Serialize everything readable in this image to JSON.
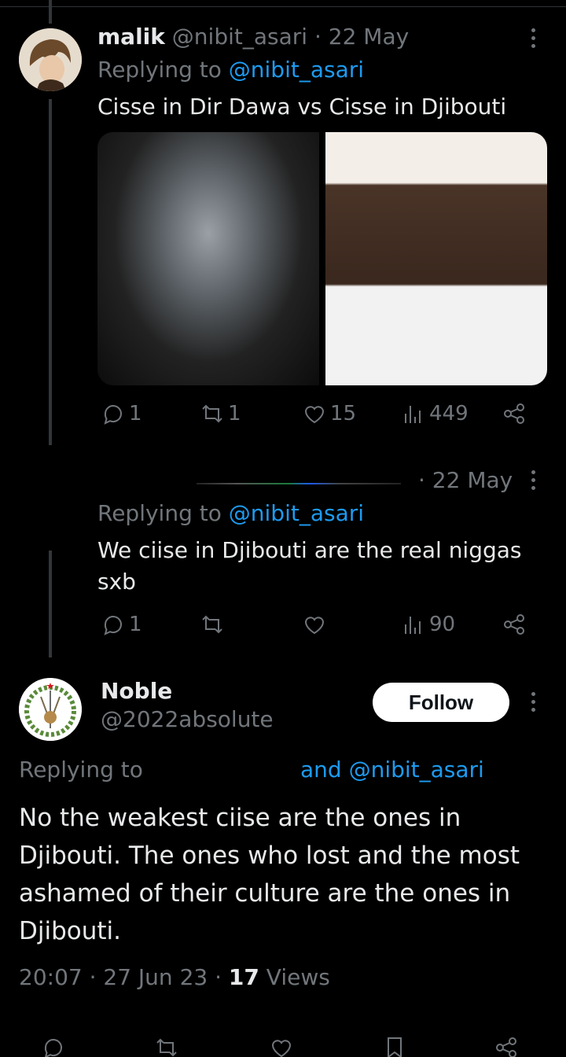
{
  "tweet1": {
    "name": "malik",
    "handle": "@nibit_asari",
    "date": "· 22 May",
    "replying_prefix": "Replying to",
    "replying_to": "@nibit_asari",
    "text": "Cisse in Dir Dawa vs Cisse in Djibouti",
    "stats": {
      "replies": "1",
      "reposts": "1",
      "likes": "15",
      "views": "449"
    }
  },
  "tweet2": {
    "date": "· 22 May",
    "replying_prefix": "Replying to",
    "replying_to": "@nibit_asari",
    "text": "We ciise in Djibouti are the real niggas sxb",
    "stats": {
      "replies": "1",
      "views": "90"
    }
  },
  "main_tweet": {
    "name": "Noble",
    "handle": "@2022absolute",
    "follow_label": "Follow",
    "replying_prefix": "Replying to",
    "replying_suffix": "and @nibit_asari",
    "text": "No the weakest ciise are the ones in Djibouti. The ones who lost and the most ashamed of their culture are the ones in Djibouti.",
    "time": "20:07 · 27 Jun 23 ·",
    "views_count": "17",
    "views_label": "Views"
  },
  "icons": {
    "reply": "reply-icon",
    "repost": "repost-icon",
    "like": "heart-icon",
    "views": "views-icon",
    "share": "share-icon",
    "more": "more-icon",
    "bookmark": "bookmark-icon"
  },
  "colors": {
    "background": "#000000",
    "text": "#e7e9ea",
    "muted": "#71767b",
    "link": "#1d9bf0"
  }
}
